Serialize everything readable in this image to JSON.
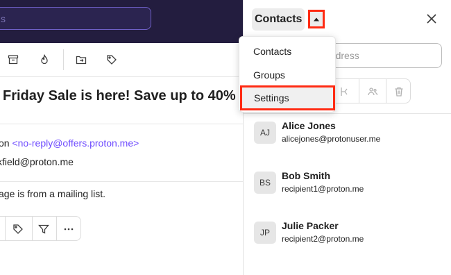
{
  "mail": {
    "search_placeholder": "s",
    "subject": "Friday Sale is here! Save up to 40%",
    "from_name": "on",
    "from_address": "<no-reply@offers.proton.me>",
    "to": "kfield@proton.me",
    "list_notice": "age is from a mailing list.",
    "toolbar_icons": [
      "archive-icon",
      "fire-icon",
      "move-icon",
      "tag-icon"
    ],
    "action_icons": [
      "tag-icon",
      "filter-icon",
      "more-icon"
    ]
  },
  "panel": {
    "title": "Contacts",
    "email_placeholder": "l address",
    "contacts": [
      {
        "initials": "AJ",
        "name": "Alice Jones",
        "email": "alicejones@protonuser.me"
      },
      {
        "initials": "BS",
        "name": "Bob Smith",
        "email": "recipient1@proton.me"
      },
      {
        "initials": "JP",
        "name": "Julie Packer",
        "email": "recipient2@proton.me"
      }
    ]
  },
  "dropdown": {
    "items": [
      "Contacts",
      "Groups",
      "Settings"
    ]
  },
  "colors": {
    "topbar": "#231d3f",
    "accent": "#6d4aff",
    "highlight": "#ff2a12"
  }
}
